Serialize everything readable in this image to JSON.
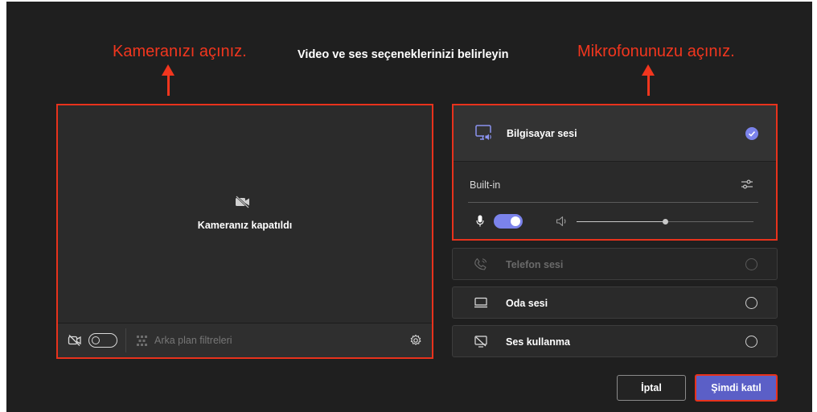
{
  "dialog": {
    "title": "Video ve ses seçeneklerinizi belirleyin"
  },
  "annotations": {
    "camera": "Kameranızı açınız.",
    "microphone": "Mikrofonunuzu açınız.",
    "color": "#f2361e"
  },
  "camera": {
    "off_message": "Kameranız kapatıldı",
    "off_icon": "video-off-icon",
    "toggle_on": false,
    "background_filters_label": "Arka plan filtreleri",
    "background_filters_icon": "background-effects-icon",
    "settings_icon": "gear-icon"
  },
  "audio": {
    "computer_audio": {
      "label": "Bilgisayar sesi",
      "icon": "computer-audio-icon",
      "selected": true,
      "device_name": "Built-in",
      "device_settings_icon": "sliders-icon",
      "mic_toggle_on": true,
      "volume_level": 0.5
    },
    "options": [
      {
        "label": "Telefon sesi",
        "icon": "phone-audio-icon",
        "selected": false,
        "disabled": true
      },
      {
        "label": "Oda sesi",
        "icon": "room-audio-icon",
        "selected": false,
        "disabled": false
      },
      {
        "label": "Ses kullanma",
        "icon": "no-audio-icon",
        "selected": false,
        "disabled": false
      }
    ]
  },
  "buttons": {
    "cancel_label": "İptal",
    "join_label": "Şimdi katıl"
  },
  "colors": {
    "accent": "#7b83eb",
    "join_button": "#5b5fc7",
    "background": "#1f1f1f",
    "highlight_border": "#e8321c"
  }
}
